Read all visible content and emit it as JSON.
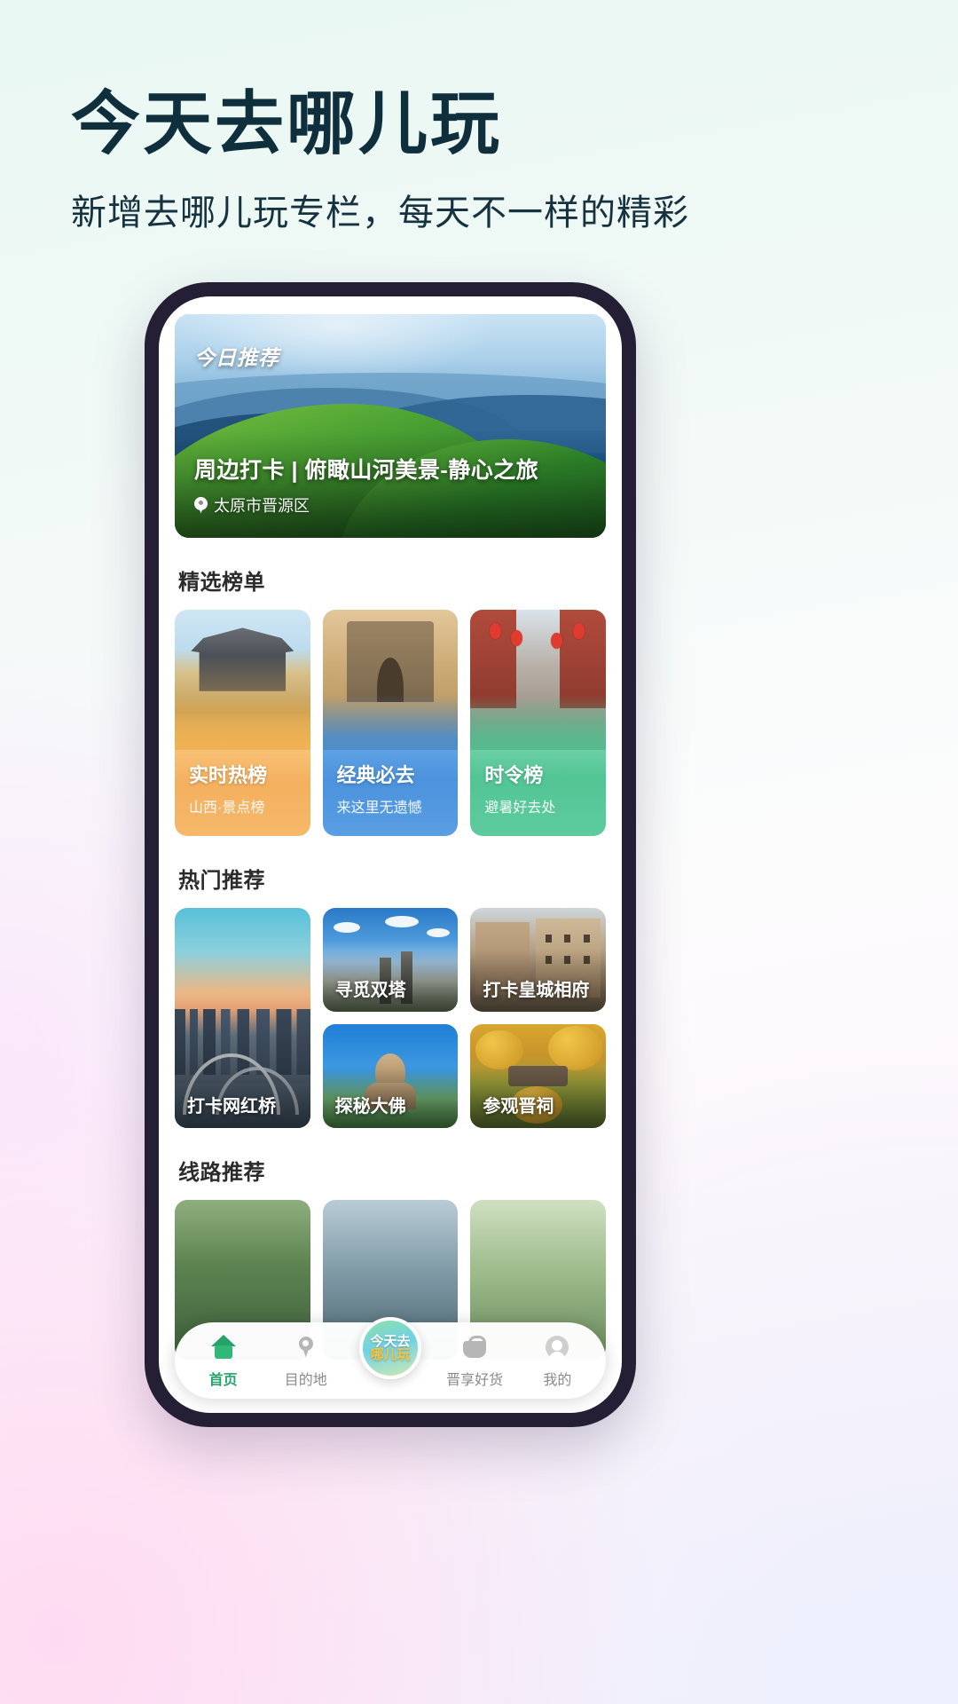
{
  "poster": {
    "headline": "今天去哪儿玩",
    "subhead": "新增去哪儿玩专栏，每天不一样的精彩",
    "headline_color": "#0f2f3d"
  },
  "app": {
    "hero": {
      "badge": "今日推荐",
      "title": "周边打卡 | 俯瞰山河美景-静心之旅",
      "location": "太原市晋源区",
      "location_icon": "location-pin-icon"
    },
    "sections": [
      {
        "id": "featured-rankings",
        "title": "精选榜单"
      },
      {
        "id": "hot-recommendations",
        "title": "热门推荐"
      },
      {
        "id": "route-recommendations",
        "title": "线路推荐"
      }
    ],
    "rank_cards": [
      {
        "title": "实时热榜",
        "subtitle": "山西·景点榜",
        "color": "#f4b05f"
      },
      {
        "title": "经典必去",
        "subtitle": "来这里无遗憾",
        "color": "#4b93dd"
      },
      {
        "title": "时令榜",
        "subtitle": "避暑好去处",
        "color": "#52c595"
      }
    ],
    "hot_tiles": [
      {
        "label": "打卡网红桥"
      },
      {
        "label": "寻觅双塔"
      },
      {
        "label": "打卡皇城相府"
      },
      {
        "label": "探秘大佛"
      },
      {
        "label": "参观晋祠"
      }
    ],
    "nav": {
      "items": [
        {
          "label": "首页",
          "icon": "home-icon",
          "active": true
        },
        {
          "label": "目的地",
          "icon": "map-pin-icon",
          "active": false
        },
        {
          "label": "晋享好货",
          "icon": "shopping-bag-icon",
          "active": false
        },
        {
          "label": "我的",
          "icon": "user-icon",
          "active": false
        }
      ],
      "center": {
        "line1": "今天去",
        "line2": "哪儿玩",
        "icon": "go-play-badge-icon"
      },
      "active_color": "#25a36a"
    }
  }
}
